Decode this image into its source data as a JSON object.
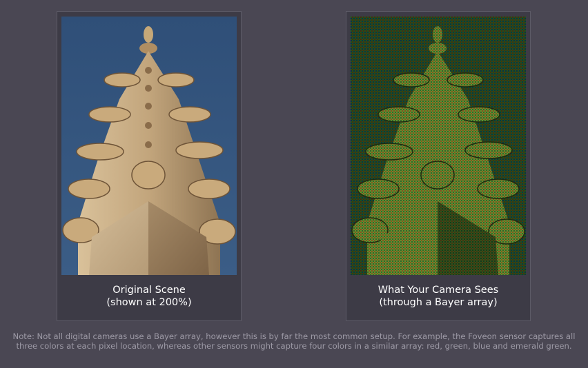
{
  "panels": [
    {
      "image_name": "original-scene-image",
      "caption_line1": "Original Scene",
      "caption_line2": "(shown at 200%)"
    },
    {
      "image_name": "bayer-array-image",
      "caption_line1": "What Your Camera Sees",
      "caption_line2": "(through a Bayer array)"
    }
  ],
  "note": "Note: Not all digital cameras use a Bayer array, however this is by far the most common setup. For example, the Foveon sensor captures all three colors at each pixel location, whereas other sensors might capture four colors in a similar array: red, green, blue and emerald green.",
  "colors": {
    "page_background": "#4a4753",
    "panel_background": "#3d3b46",
    "sky_blue": "#3a5a80",
    "stone_tan": "#b9996c",
    "bayer_green": "#2f6b1a",
    "note_text": "#9d9aa6"
  }
}
